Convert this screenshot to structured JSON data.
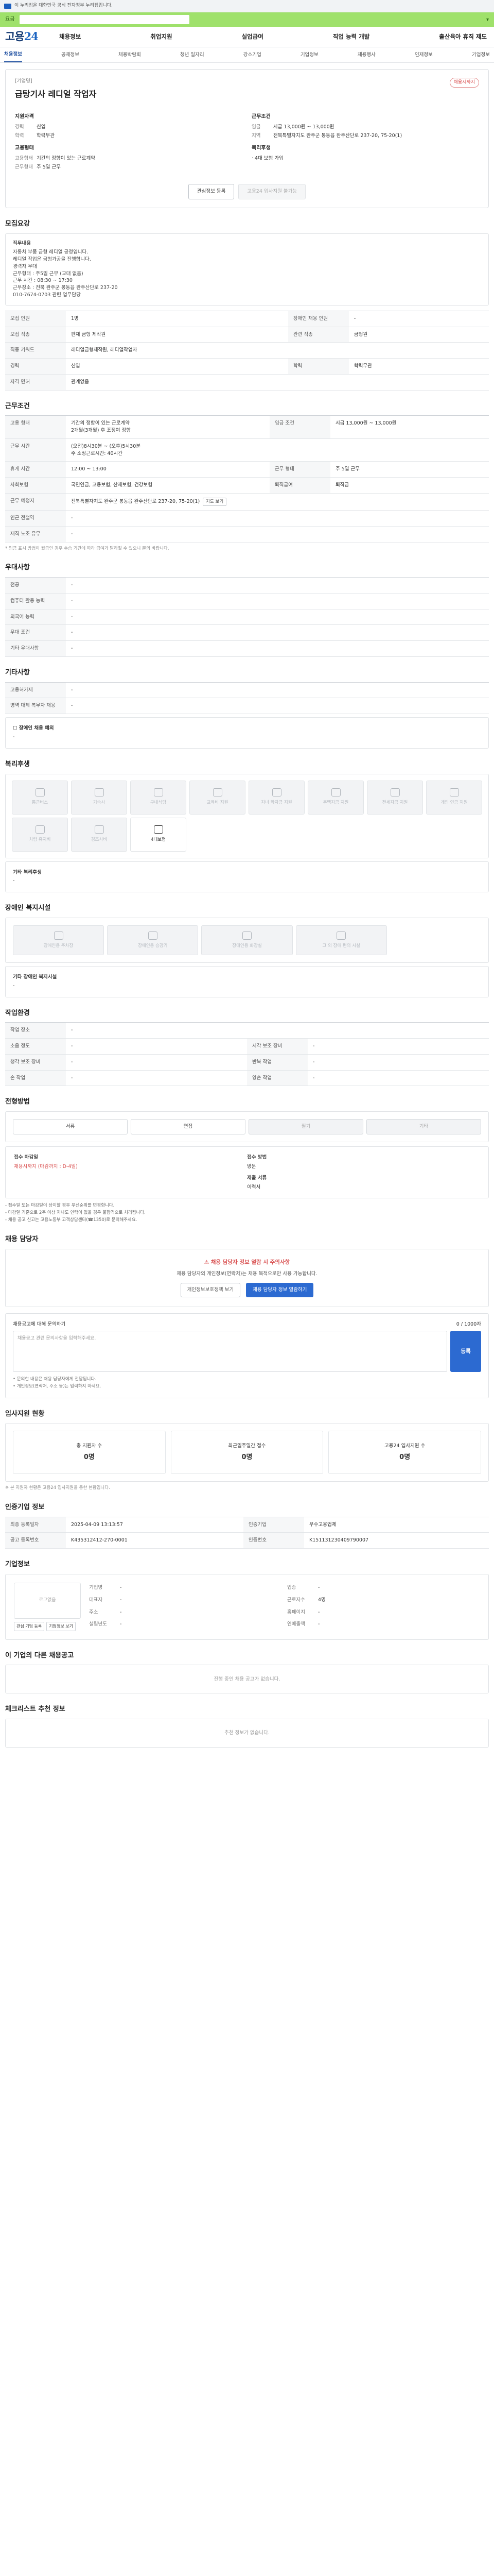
{
  "topbar": {
    "text": "이 누리집은 대한민국 공식 전자정부 누리집입니다."
  },
  "greenbar": {
    "label": "요금",
    "label2": "가입"
  },
  "header": {
    "logo_a": "고용",
    "logo_b": "24"
  },
  "gnb": [
    "채용정보",
    "취업지원",
    "실업급여",
    "직업 능력 개발",
    "출산육아 휴직 제도"
  ],
  "subnav": [
    "채용정보",
    "공채정보",
    "채용박람회",
    "청년 일자리",
    "강소기업",
    "기업정보",
    "채용행사",
    "인재정보",
    "기업정보"
  ],
  "job": {
    "company_label": "지원기업",
    "company": "[기업명]",
    "title": "급탕기사 레디얼 작업자",
    "badge": "채용시까지",
    "summary": {
      "left_title": "지원자격",
      "left": [
        {
          "k": "경력",
          "v": "신입"
        },
        {
          "k": "학력",
          "v": "학력무관"
        }
      ],
      "right_title": "근무조건",
      "right": [
        {
          "k": "임금",
          "v": "시급 13,000원 ~ 13,000원"
        },
        {
          "k": "지역",
          "v": "전북특별자치도 완주군 봉동읍 완주산단로 237-20, 75-20(1)"
        }
      ],
      "left2_title": "고용형태",
      "left2": [
        {
          "k": "고용형태",
          "v": "기간의 정함이 있는 근로계약"
        },
        {
          "k": "근무형태",
          "v": "주 5일 근무"
        }
      ],
      "right2_title": "복리후생",
      "right2": [
        {
          "k": "",
          "v": "· 4대 보험 가입"
        }
      ]
    },
    "btn_scrap": "관심정보 등록",
    "btn_apply": "고용24 입사지원 불가능"
  },
  "sections": {
    "recruit": "모집요강",
    "work": "근무조건",
    "prefer": "우대사항",
    "other": "기타사항",
    "welfare": "복리후생",
    "disability": "장애인 복지시설",
    "environment": "작업환경",
    "selection": "전형방법",
    "contact": "채용 담당자",
    "qa": "채용공고 문의하기",
    "applicants": "입사지원 현황",
    "info": "인증기업 정보",
    "corp": "기업정보",
    "other_jobs": "이 기업의 다른 채용공고",
    "recommended": "체크리스트 추천 정보"
  },
  "recruit_box": {
    "h": "직무내용",
    "lines": [
      "자동차 부품 금형 레디얼 공정입니다.",
      "레디얼 작업은 금형가공을 진행합니다.",
      "경력자 우대",
      "근무형태 : 주5일 근무 (교대 없음)",
      "근무 시간 : 08:30 ~ 17:30",
      "근무장소 : 전북 완주군 봉동읍 완주산단로 237-20",
      "010-7674-0703 관련 업무담당"
    ]
  },
  "recruit_table": [
    [
      "모집 인원",
      "1명",
      "장애인 채용 인원",
      "-"
    ],
    [
      "모집 직종",
      "판재 금형 제작원",
      "관련 직종",
      "금형원"
    ],
    [
      "직종 키워드",
      "레디얼금형제작원, 레디얼작업자",
      "",
      ""
    ],
    [
      "경력",
      "신입",
      "학력",
      "학력무관"
    ],
    [
      "자격 면허",
      "관계없음",
      "",
      ""
    ]
  ],
  "work_table": [
    [
      "고용 형태",
      "기간의 정함이 있는 근로계약\n2개월(3개월) 후 조정여 정함",
      "임금 조건",
      "시급 13,000원 ~ 13,000원"
    ],
    [
      "근무 시간",
      "(오전)8시30분 ~ (오후)5시30분\n주 소정근로시간: 40시간",
      "",
      ""
    ],
    [
      "휴게 시간",
      "12:00 ~ 13:00",
      "근무 형태",
      "주 5일 근무"
    ],
    [
      "사회보험",
      "국민연금, 고용보험, 산재보험, 건강보험",
      "퇴직급여",
      "퇴직금"
    ],
    [
      "근무 예정지",
      "전북특별자치도 완주군 봉동읍 완주산단로 237-20, 75-20(1)",
      "",
      ""
    ],
    [
      "인근 전철역",
      "-",
      "",
      ""
    ],
    [
      "재직 노조 유무",
      "-",
      "",
      ""
    ]
  ],
  "work_note": "* 임금 표시 방법이 월급인 경우 수습 기간에 따라 급여가 달라질 수 있으니 문의 바랍니다.",
  "prefer_table": [
    [
      "전공",
      "-"
    ],
    [
      "컴퓨터 활용 능력",
      "-"
    ],
    [
      "외국어 능력",
      "-"
    ],
    [
      "우대 조건",
      "-"
    ],
    [
      "기타 우대사항",
      "-"
    ]
  ],
  "other_table": [
    [
      "고용허가제",
      "-"
    ],
    [
      "병역 대체 복무자 채용",
      "-"
    ]
  ],
  "barrier": {
    "h": "☐ 장애인 채용 예외",
    "v": "-"
  },
  "welfare_tiles": [
    {
      "label": "통근버스",
      "on": false
    },
    {
      "label": "기숙사",
      "on": false
    },
    {
      "label": "구내식당",
      "on": false
    },
    {
      "label": "교육비 지원",
      "on": false
    },
    {
      "label": "자녀 학자금 지원",
      "on": false
    },
    {
      "label": "주택자금 지원",
      "on": false
    },
    {
      "label": "전세자금 지원",
      "on": false
    },
    {
      "label": "개인 연금 지원",
      "on": false
    },
    {
      "label": "차량 유지비",
      "on": false
    },
    {
      "label": "경조사비",
      "on": false
    },
    {
      "label": "4대보험",
      "on": true
    }
  ],
  "welfare_other": {
    "h": "기타 복리후생",
    "v": "-"
  },
  "disability_tiles": [
    "장애인용 주차장",
    "장애인용 승강기",
    "장애인용 화장실",
    "그 외 장애 편의 시설"
  ],
  "disability_other": {
    "h": "기타 장애인 복지시설",
    "v": "-"
  },
  "env_table": [
    [
      "작업 장소",
      "-",
      "",
      ""
    ],
    [
      "소음 정도",
      "-",
      "시각 보조 장비",
      "-"
    ],
    [
      "청각 보조 장비",
      "-",
      "반복 작업",
      "-"
    ],
    [
      "손 작업",
      "-",
      "양손 작업",
      "-"
    ]
  ],
  "selection_tabs": [
    {
      "label": "서류",
      "on": true
    },
    {
      "label": "면접",
      "on": true
    },
    {
      "label": "필기",
      "on": false
    },
    {
      "label": "기타",
      "on": false
    }
  ],
  "deadline": {
    "h1": "접수 마감일",
    "v1": "채용시까지 (마감까지 : D-4일)",
    "h2": "접수 방법",
    "v2": "방문",
    "h3": "제출 서류",
    "v3": "이력서"
  },
  "selection_notes": [
    "- 접수일 또는 마감일이 상이할 경우 우선순위를 변경합니다.",
    "- 마감일 기준으로 2주 이상 지나도 연락이 없을 경우 불합격으로 처리됩니다.",
    "- 채용 공고 신고는 고용노동부 고객상담센터(☎1350)로 문의해주세요."
  ],
  "contact": {
    "warn": "채용 담당자 정보 열람 시 주의사항",
    "desc": "채용 담당자의 개인정보(연락처)는 채용 목적으로만 사용 가능합니다.",
    "btn1": "개인정보보호정책 보기",
    "btn2": "채용 담당자 정보 열람하기"
  },
  "qa": {
    "label": "채용공고에 대해 문의하기",
    "counter": "0 / 1000자",
    "placeholder": "채용공고 관련 문의사항을 입력해주세요.",
    "btn": "등록",
    "notes": [
      "• 문의한 내용은 채용 담당자에게 전달됩니다.",
      "• 개인정보(연락처, 주소 등)는 입력하지 마세요."
    ]
  },
  "applicants": [
    {
      "h": "총 지원자 수",
      "v": "0명"
    },
    {
      "h": "최근일주일간 접수",
      "v": "0명"
    },
    {
      "h": "고용24 입사지원 수",
      "v": "0명"
    }
  ],
  "applicants_note": "※ 본 지원자 현황은 고용24 입사지원을 통한 현황입니다.",
  "cert_table": [
    [
      "최종 등록일자",
      "2025-04-09 13:13:57",
      "인증기업",
      "우수고용업체"
    ],
    [
      "공고 등록번호",
      "K435312412-270-0001",
      "인증번호",
      "K151131230409790007"
    ]
  ],
  "corp": {
    "logo": "로고없음",
    "mini1": "관심 기업 등록",
    "mini2": "기업정보 보기",
    "fields": [
      {
        "k": "기업명",
        "v": "-"
      },
      {
        "k": "업종",
        "v": "-"
      },
      {
        "k": "대표자",
        "v": "-"
      },
      {
        "k": "근로자수",
        "v": "4명"
      },
      {
        "k": "주소",
        "v": "-"
      },
      {
        "k": "홈페이지",
        "v": "-"
      },
      {
        "k": "설립년도",
        "v": "-"
      },
      {
        "k": "연매출액",
        "v": "-"
      }
    ]
  },
  "other_jobs_empty": "진행 중인 채용 공고가 없습니다.",
  "recommended_empty": "추천 정보가 없습니다."
}
